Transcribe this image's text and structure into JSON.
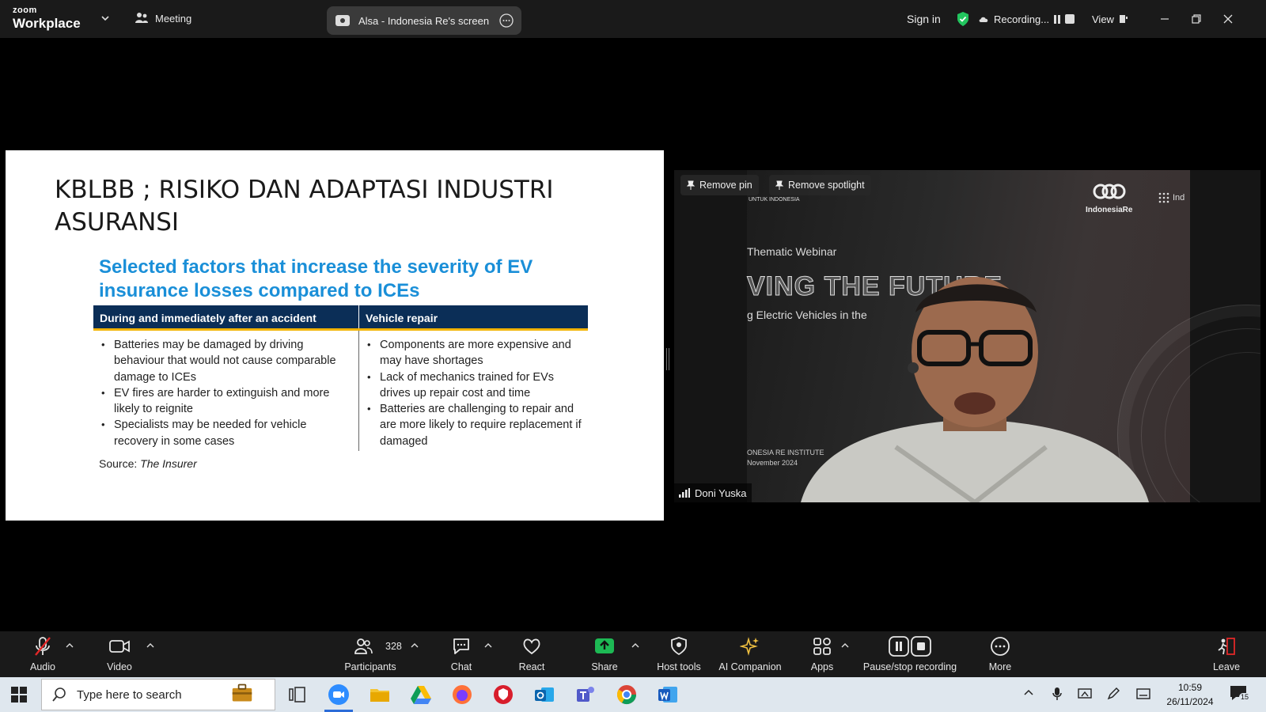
{
  "app": {
    "brand_top": "zoom",
    "brand_bottom": "Workplace",
    "meeting_label": "Meeting",
    "share_title": "Alsa - Indonesia Re's screen",
    "sign_in": "Sign in",
    "recording_label": "Recording...",
    "view_label": "View"
  },
  "slide": {
    "title": "KBLBB ; RISIKO DAN ADAPTASI INDUSTRI ASURANSI",
    "subtitle": "Selected factors that increase the severity of EV insurance losses compared to ICEs",
    "table": {
      "headers": [
        "During and immediately after an accident",
        "Vehicle repair"
      ],
      "col1": [
        "Batteries may be damaged by driving behaviour that would not cause comparable damage to ICEs",
        "EV fires are harder to extinguish and more likely to reignite",
        "Specialists may be needed for vehicle recovery in some cases"
      ],
      "col2": [
        "Components are more expensive and may have shortages",
        "Lack of mechanics trained for EVs drives up repair cost and time",
        "Batteries are challenging to repair and are more likely to require replacement if damaged"
      ]
    },
    "source_prefix": "Source: ",
    "source_name": "The Insurer"
  },
  "video": {
    "remove_pin": "Remove pin",
    "remove_spotlight": "Remove spotlight",
    "participant_name": "Doni Yuska",
    "bg_logo_name": "IndonesiaRe",
    "bg_logo_right": "Ind",
    "bg_logo_left": "UNTUK INDONESIA",
    "bg_small": "Thematic Webinar",
    "bg_big": "VING THE FUTURE",
    "bg_mid": "g Electric Vehicles in the",
    "bg_foot1": "ONESIA RE INSTITUTE",
    "bg_foot2": "November 2024"
  },
  "toolbar": {
    "audio": "Audio",
    "video": "Video",
    "participants": "Participants",
    "participants_count": "328",
    "chat": "Chat",
    "react": "React",
    "share": "Share",
    "host_tools": "Host tools",
    "ai_companion": "AI Companion",
    "apps": "Apps",
    "pause_stop": "Pause/stop recording",
    "more": "More",
    "leave": "Leave"
  },
  "taskbar": {
    "search_placeholder": "Type here to search",
    "time": "10:59",
    "date": "26/11/2024",
    "notif_count": "15"
  },
  "colors": {
    "accent_blue": "#1a8fd8",
    "table_header": "#0b2e57",
    "table_rule": "#f2b300",
    "share_green": "#1db954",
    "leave_red": "#e02828"
  }
}
